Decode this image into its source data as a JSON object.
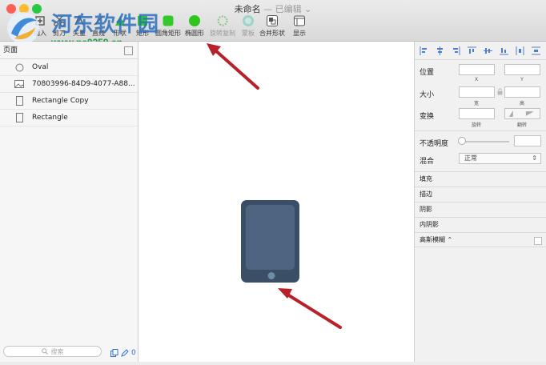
{
  "window": {
    "title": "未命名",
    "status": "— 已编辑",
    "status_chevron": "⌄"
  },
  "toolbar": {
    "items": [
      {
        "label": "插入",
        "icon": "insert-icon"
      },
      {
        "label": "剪刀",
        "icon": "scissors-icon"
      },
      {
        "label": "矢量",
        "icon": "vector-icon"
      },
      {
        "label": "直线",
        "icon": "line-icon"
      },
      {
        "label": "形状",
        "icon": "shape-icon"
      },
      {
        "label": "矩形",
        "icon": "rectangle-icon"
      },
      {
        "label": "圆角矩形",
        "icon": "rounded-rect-icon"
      },
      {
        "label": "椭圆形",
        "icon": "oval-icon"
      },
      {
        "label": "旋转复制",
        "icon": "rotate-copy-icon"
      },
      {
        "label": "蒙板",
        "icon": "mask-icon"
      },
      {
        "label": "合并形状",
        "icon": "combine-shapes-icon"
      },
      {
        "label": "显示",
        "icon": "display-icon"
      }
    ]
  },
  "watermark": {
    "title": "河东软件园",
    "url": "www.pc0359.cn"
  },
  "left_panel": {
    "pages_header": "页面",
    "layers": [
      {
        "name": "Oval",
        "icon": "oval-layer-icon"
      },
      {
        "name": "70803996-84D9-4077-A88...",
        "icon": "image-layer-icon"
      },
      {
        "name": "Rectangle Copy",
        "icon": "rectangle-layer-icon"
      },
      {
        "name": "Rectangle",
        "icon": "rectangle-layer-icon"
      }
    ],
    "search_placeholder": "搜索",
    "bottom_count": "0"
  },
  "inspector": {
    "position_label": "位置",
    "x_label": "X",
    "y_label": "Y",
    "size_label": "大小",
    "width_label": "宽",
    "height_label": "高",
    "transform_label": "变换",
    "rotate_label": "旋转",
    "flip_label": "翻转",
    "opacity_label": "不透明度",
    "blend_label": "混合",
    "blend_value": "正常",
    "sections": [
      "填充",
      "描边",
      "阴影",
      "内阴影",
      "高斯模糊 ⌃"
    ]
  },
  "colors": {
    "device_body": "#3a4e66",
    "device_screen": "#4d6580",
    "device_button": "#6e8ba8",
    "arrow": "#b8202a",
    "oval_tool": "#2fc51c",
    "rect_tool": "#33c92a"
  }
}
